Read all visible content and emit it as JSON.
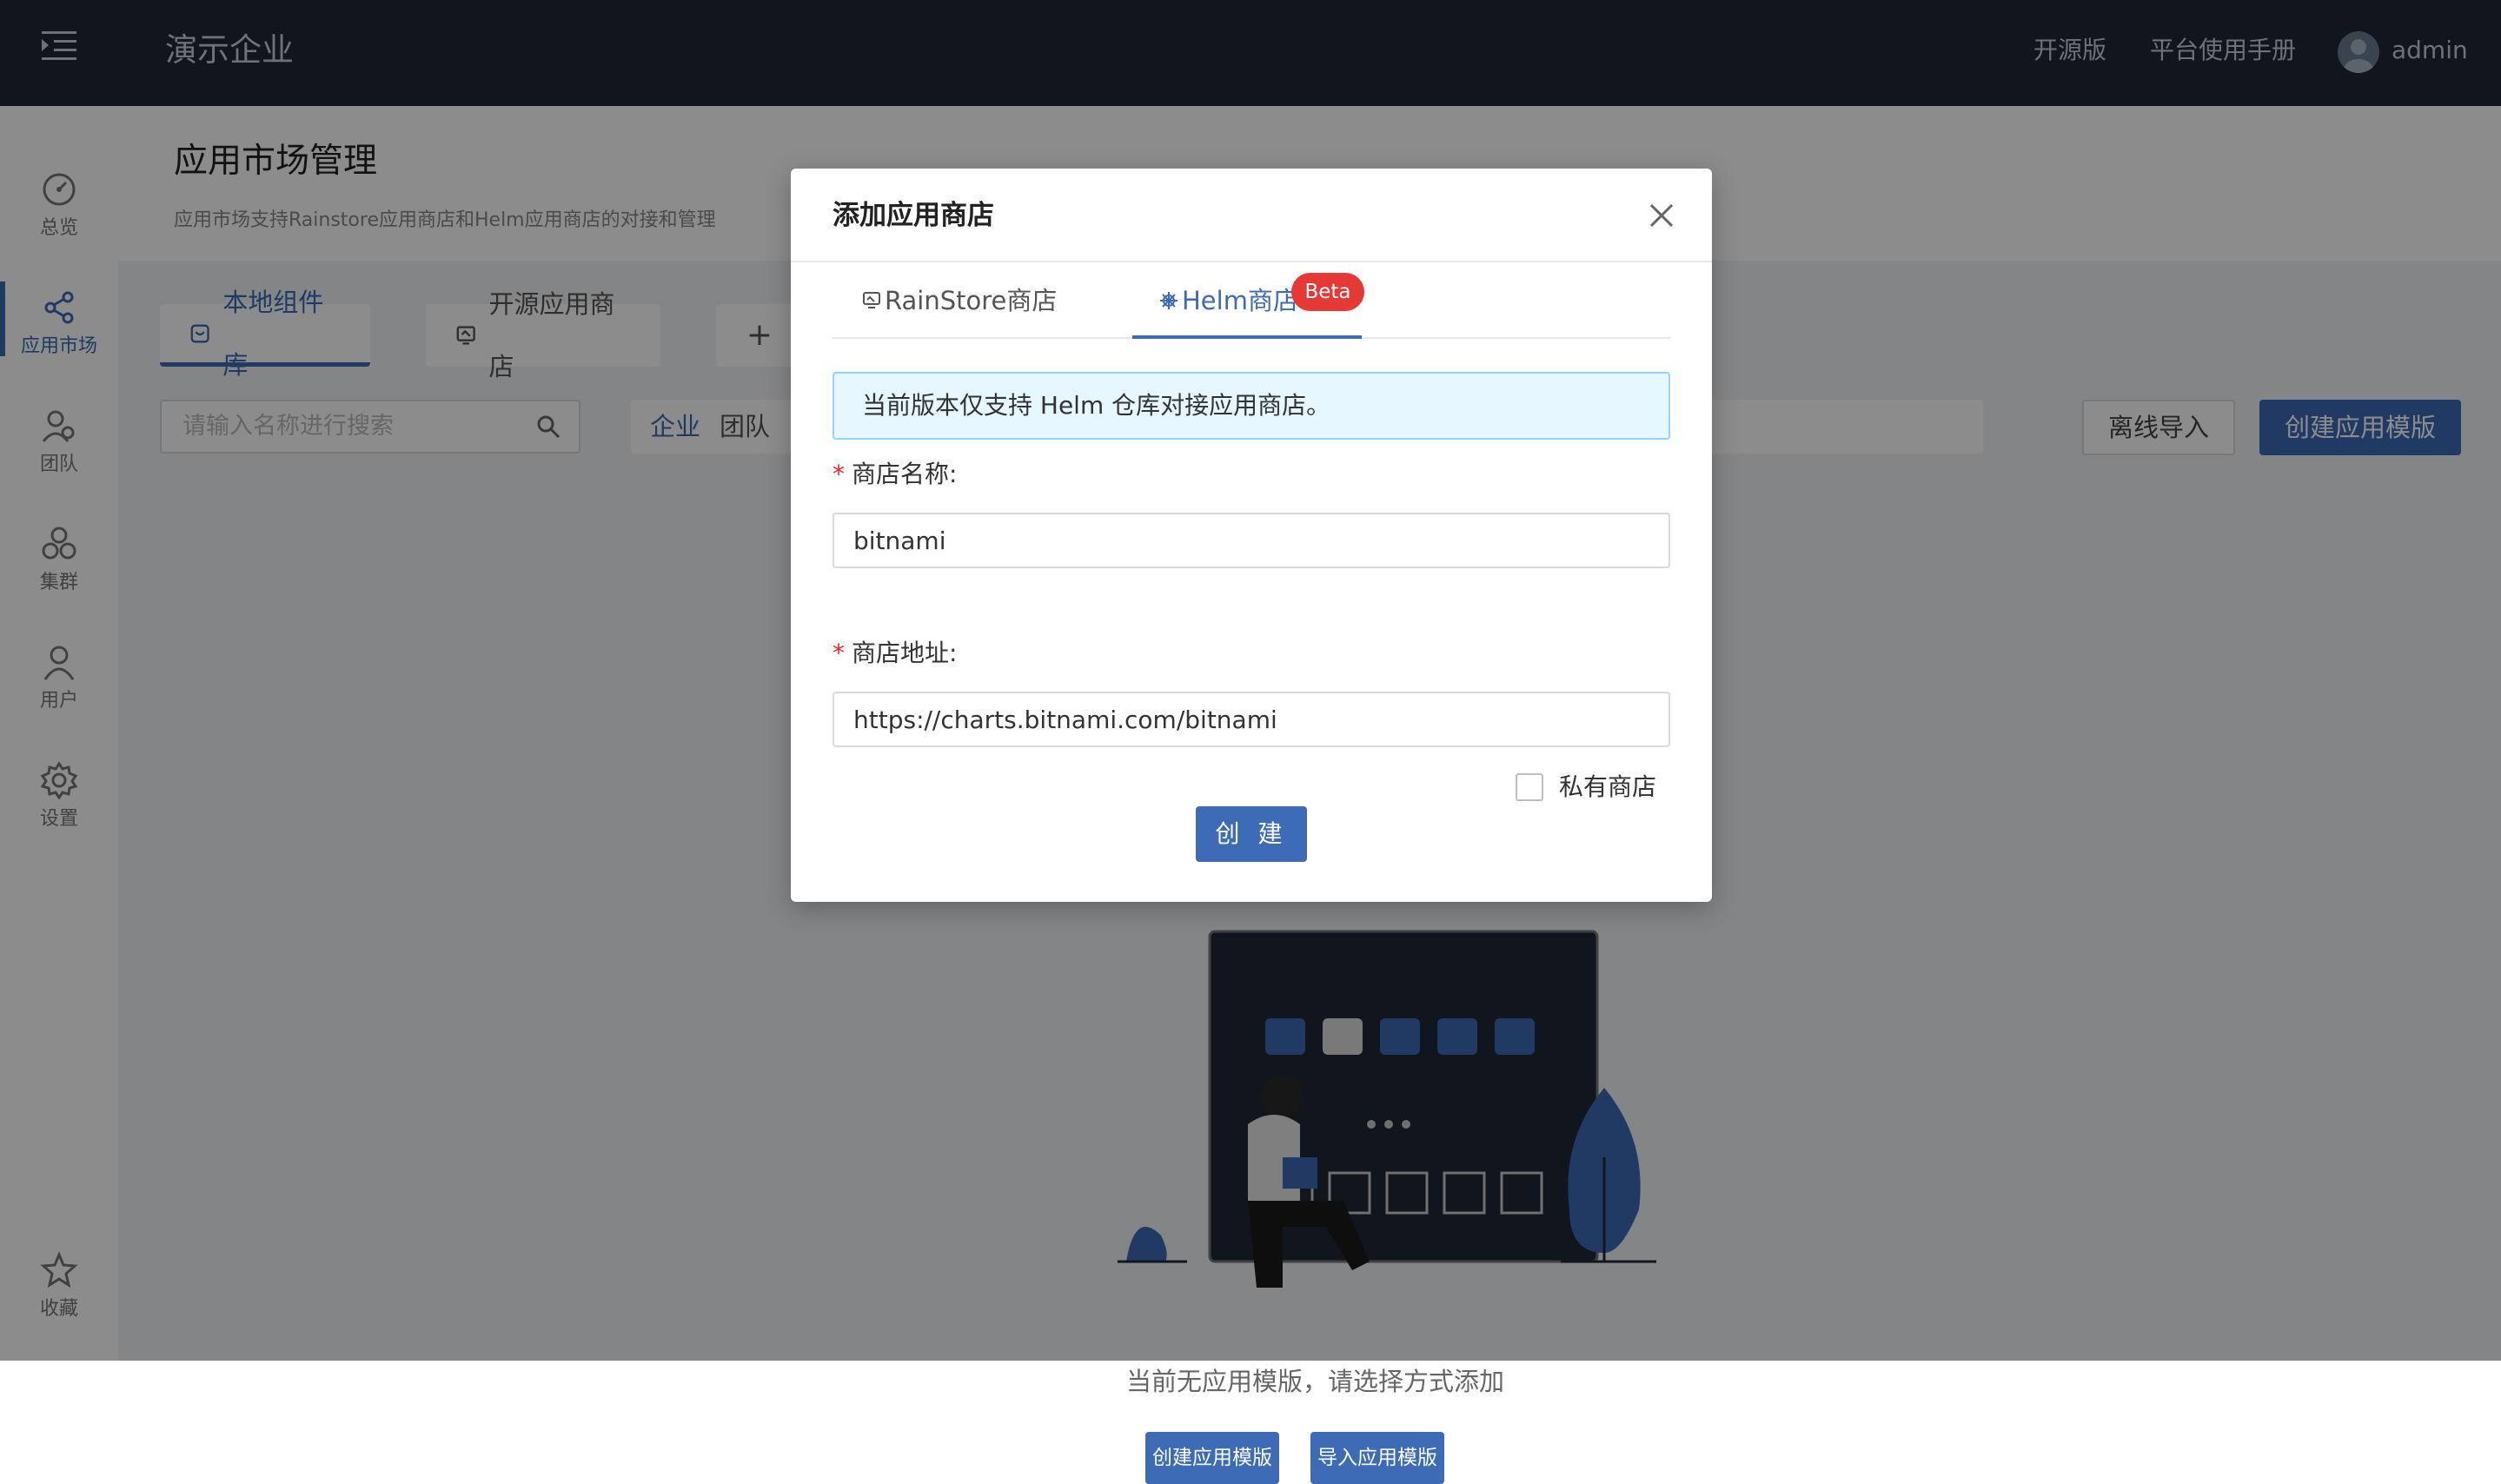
{
  "header": {
    "enterprise_name": "演示企业",
    "links": [
      "开源版",
      "平台使用手册"
    ],
    "username": "admin"
  },
  "sidebar": {
    "items": [
      {
        "label": "总览",
        "icon": "dashboard-icon"
      },
      {
        "label": "应用市场",
        "icon": "share-icon",
        "active": true
      },
      {
        "label": "团队",
        "icon": "team-icon"
      },
      {
        "label": "集群",
        "icon": "cluster-icon"
      },
      {
        "label": "用户",
        "icon": "user-icon"
      },
      {
        "label": "设置",
        "icon": "gear-icon"
      },
      {
        "label": "收藏",
        "icon": "star-icon"
      }
    ]
  },
  "page": {
    "title": "应用市场管理",
    "description": "应用市场支持Rainstore应用商店和Helm应用商店的对接和管理",
    "tabs": [
      {
        "label": "本地组件库",
        "active": true
      },
      {
        "label": "开源应用商店"
      },
      {
        "label": "+"
      }
    ],
    "search_placeholder": "请输入名称进行搜索",
    "filters": [
      "企业",
      "团队"
    ],
    "offline_import": "离线导入",
    "create_template": "创建应用模版",
    "empty_text": "当前无应用模版，请选择方式添加",
    "empty_buttons": [
      "创建应用模版",
      "导入应用模版"
    ]
  },
  "modal": {
    "title": "添加应用商店",
    "tabs": [
      {
        "label": "RainStore商店"
      },
      {
        "label": "Helm商店",
        "active": true
      }
    ],
    "beta": "Beta",
    "alert": "当前版本仅支持 Helm 仓库对接应用商店。",
    "store_name_label": "商店名称:",
    "store_name_value": "bitnami",
    "store_url_label": "商店地址:",
    "store_url_value": "https://charts.bitnami.com/bitnami",
    "private_label": "私有商店",
    "submit": "创 建"
  },
  "colors": {
    "primary": "#3d6bb6",
    "header_bg": "#1f2738",
    "beta": "#e53935",
    "alert_bg": "#e6f7ff"
  }
}
